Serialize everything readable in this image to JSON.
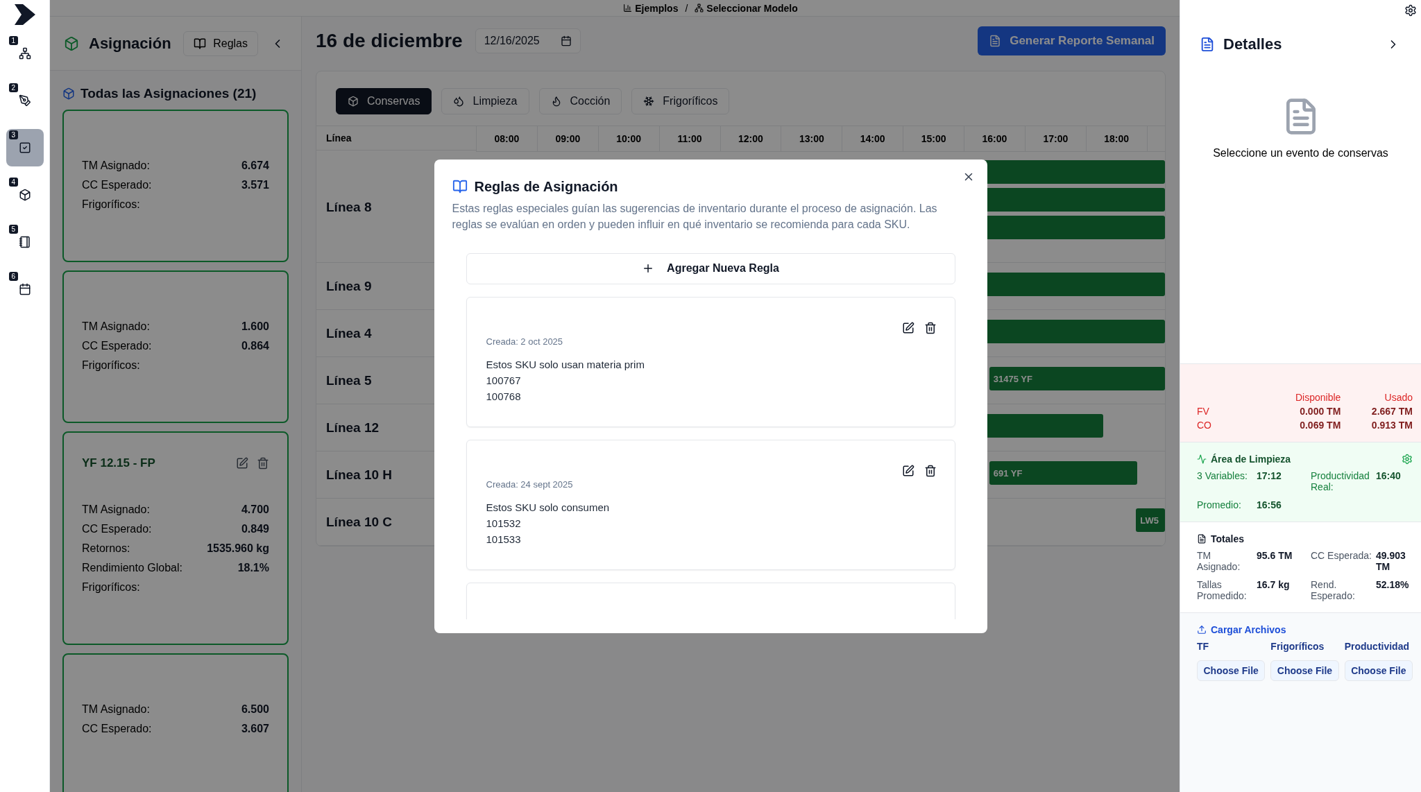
{
  "breadcrumb": [
    {
      "label": "Ejemplos"
    },
    {
      "label": "Seleccionar Modelo"
    }
  ],
  "breadcrumb_separator": "/",
  "rail": [
    {
      "number": "1",
      "selected": false
    },
    {
      "number": "2",
      "selected": false
    },
    {
      "number": "3",
      "selected": true
    },
    {
      "number": "4",
      "selected": false
    },
    {
      "number": "5",
      "selected": false
    },
    {
      "number": "6",
      "selected": false
    }
  ],
  "assignment_panel": {
    "title": "Asignación",
    "rules_button": "Reglas",
    "list_title": "Todas las Asignaciones (21)",
    "cards": [
      {
        "rows": [
          {
            "label": "TM Asignado:",
            "value": "6.674"
          },
          {
            "label": "CC Esperado:",
            "value": "3.571"
          }
        ],
        "footer": "Frigoríficos:"
      },
      {
        "rows": [
          {
            "label": "TM Asignado:",
            "value": "1.600"
          },
          {
            "label": "CC Esperado:",
            "value": "0.864"
          }
        ],
        "footer": "Frigoríficos:"
      },
      {
        "title": "YF 12.15 - FP",
        "rows": [
          {
            "label": "TM Asignado:",
            "value": "4.700"
          },
          {
            "label": "CC Esperado:",
            "value": "0.849"
          },
          {
            "label": "Retornos:",
            "value": "1535.960 kg"
          },
          {
            "label": "Rendimiento Global:",
            "value": "18.1%"
          }
        ],
        "footer": "Frigoríficos:"
      },
      {
        "rows": [
          {
            "label": "TM Asignado:",
            "value": "6.500"
          },
          {
            "label": "CC Esperado:",
            "value": "3.607"
          }
        ]
      }
    ]
  },
  "main": {
    "title": "16 de diciembre",
    "date_value": "12/16/2025",
    "report_button": "Generar Reporte Semanal",
    "tabs": [
      {
        "label": "Conservas",
        "selected": true
      },
      {
        "label": "Limpieza",
        "selected": false
      },
      {
        "label": "Cocción",
        "selected": false
      },
      {
        "label": "Frigoríficos",
        "selected": false
      }
    ],
    "line_header": "Línea",
    "hours": [
      "08:00",
      "09:00",
      "10:00",
      "11:00",
      "12:00",
      "13:00",
      "14:00",
      "15:00",
      "16:00",
      "17:00",
      "18:00"
    ],
    "lines": [
      {
        "name": "Línea 8"
      },
      {
        "name": "Línea 9"
      },
      {
        "name": "Línea 4"
      },
      {
        "name": "Línea 5",
        "bar_label": "31475 YF"
      },
      {
        "name": "Línea 12"
      },
      {
        "name": "Línea 10 H",
        "bar_label": "691 YF"
      },
      {
        "name": "Línea 10 C",
        "bar_label": "LW5"
      }
    ]
  },
  "details": {
    "title": "Detalles",
    "empty_text": "Seleccione un evento de conservas",
    "returns": {
      "columns": [
        "Disponible",
        "Usado"
      ],
      "rows": [
        {
          "name": "FV",
          "available": "0.000 TM",
          "used": "2.667 TM"
        },
        {
          "name": "CO",
          "available": "0.069 TM",
          "used": "0.913 TM"
        }
      ]
    },
    "cleaning": {
      "title": "Área de Limpieza",
      "items": [
        {
          "label": "3 Variables:",
          "value": "17:12"
        },
        {
          "label": "Productividad Real:",
          "value": "16:40"
        },
        {
          "label": "Promedio:",
          "value": "16:56"
        }
      ]
    },
    "totals": {
      "title": "Totales",
      "items": [
        {
          "label": "TM Asignado:",
          "value": "95.6 TM"
        },
        {
          "label": "CC Esperada:",
          "value": "49.903 TM"
        },
        {
          "label": "Tallas Promedido:",
          "value": "16.7 kg"
        },
        {
          "label": "Rend. Esperado:",
          "value": "52.18%"
        }
      ]
    },
    "uploads": {
      "title": "Cargar Archivos",
      "files": [
        {
          "label": "TF",
          "button": "Choose File"
        },
        {
          "label": "Frigoríficos",
          "button": "Choose File"
        },
        {
          "label": "Productividad",
          "button": "Choose File"
        }
      ]
    }
  },
  "dialog": {
    "title": "Reglas de Asignación",
    "description": "Estas reglas especiales guían las sugerencias de inventario durante el proceso de asignación. Las reglas se evalúan en orden y pueden influir en qué inventario se recomienda para cada SKU.",
    "add_button": "Agregar Nueva Regla",
    "rules": [
      {
        "created": "Creada: 2 oct 2025",
        "lines": [
          "Estos SKU solo usan materia prim",
          "100767",
          "100768"
        ]
      },
      {
        "created": "Creada: 24 sept 2025",
        "lines": [
          "Estos SKU solo consumen",
          "101532",
          "101533"
        ]
      }
    ]
  }
}
